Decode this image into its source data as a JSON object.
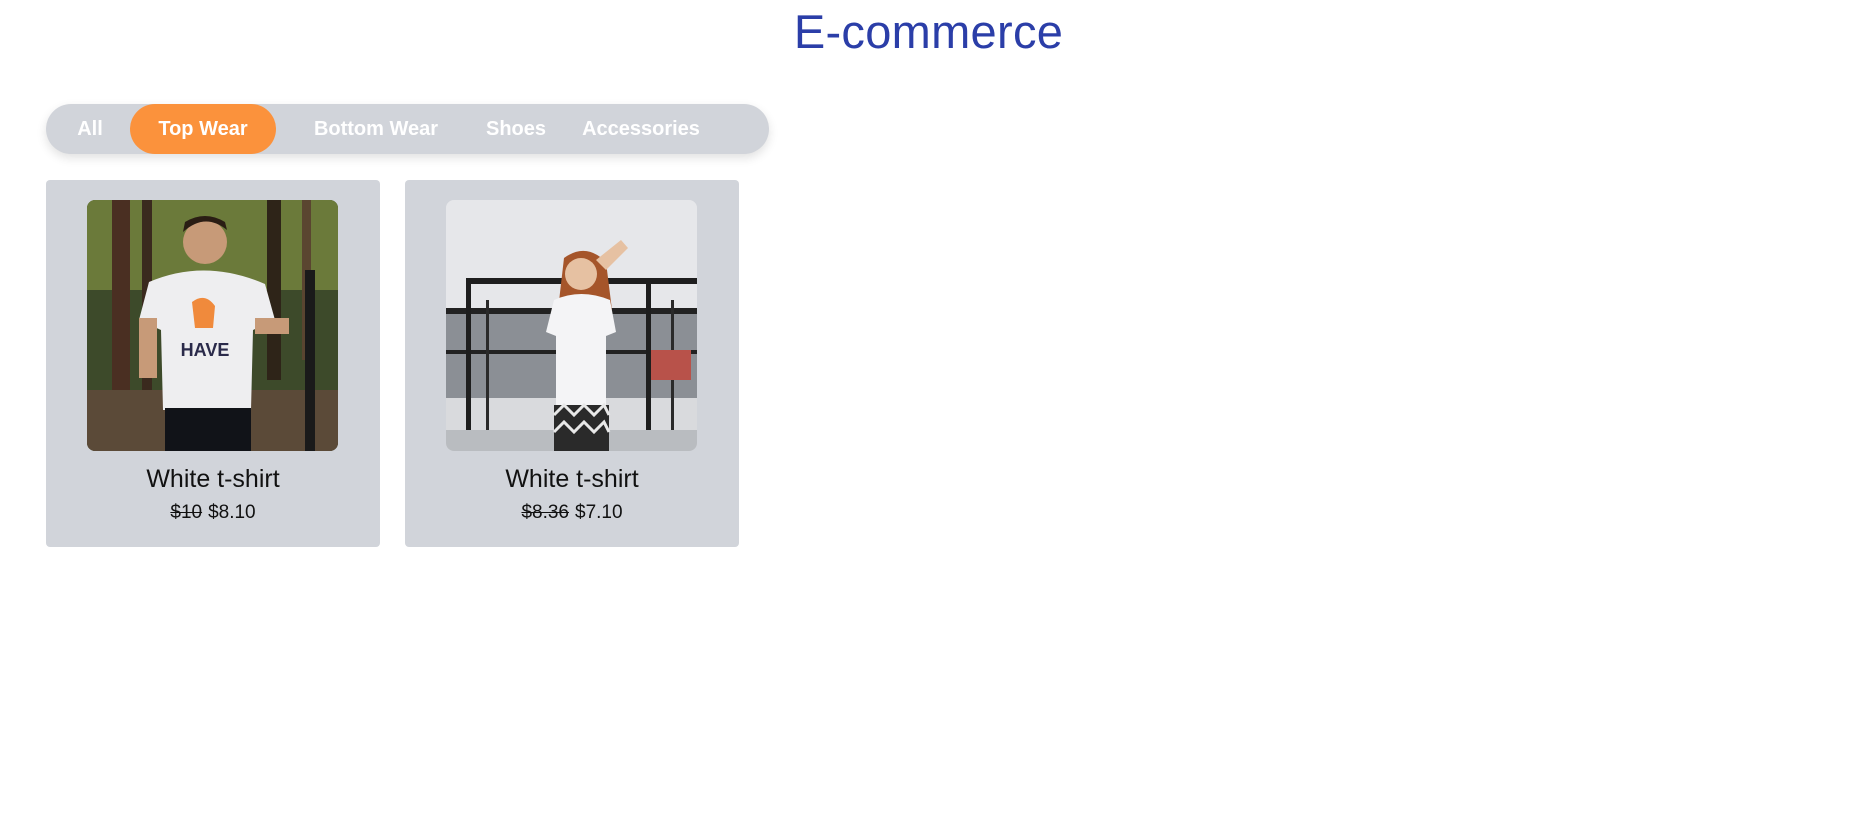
{
  "header": {
    "title": "E-commerce"
  },
  "tabs": [
    {
      "label": "All",
      "active": false
    },
    {
      "label": "Top Wear",
      "active": true
    },
    {
      "label": "Bottom Wear",
      "active": false
    },
    {
      "label": "Shoes",
      "active": false
    },
    {
      "label": "Accessories",
      "active": false
    }
  ],
  "products": [
    {
      "name": "White t-shirt",
      "old_price": "$10",
      "price": "$8.10"
    },
    {
      "name": "White t-shirt",
      "old_price": "$8.36",
      "price": "$7.10"
    }
  ],
  "colors": {
    "title": "#2b3ea8",
    "active_tab": "#fb923c",
    "panel": "#d1d4da"
  }
}
